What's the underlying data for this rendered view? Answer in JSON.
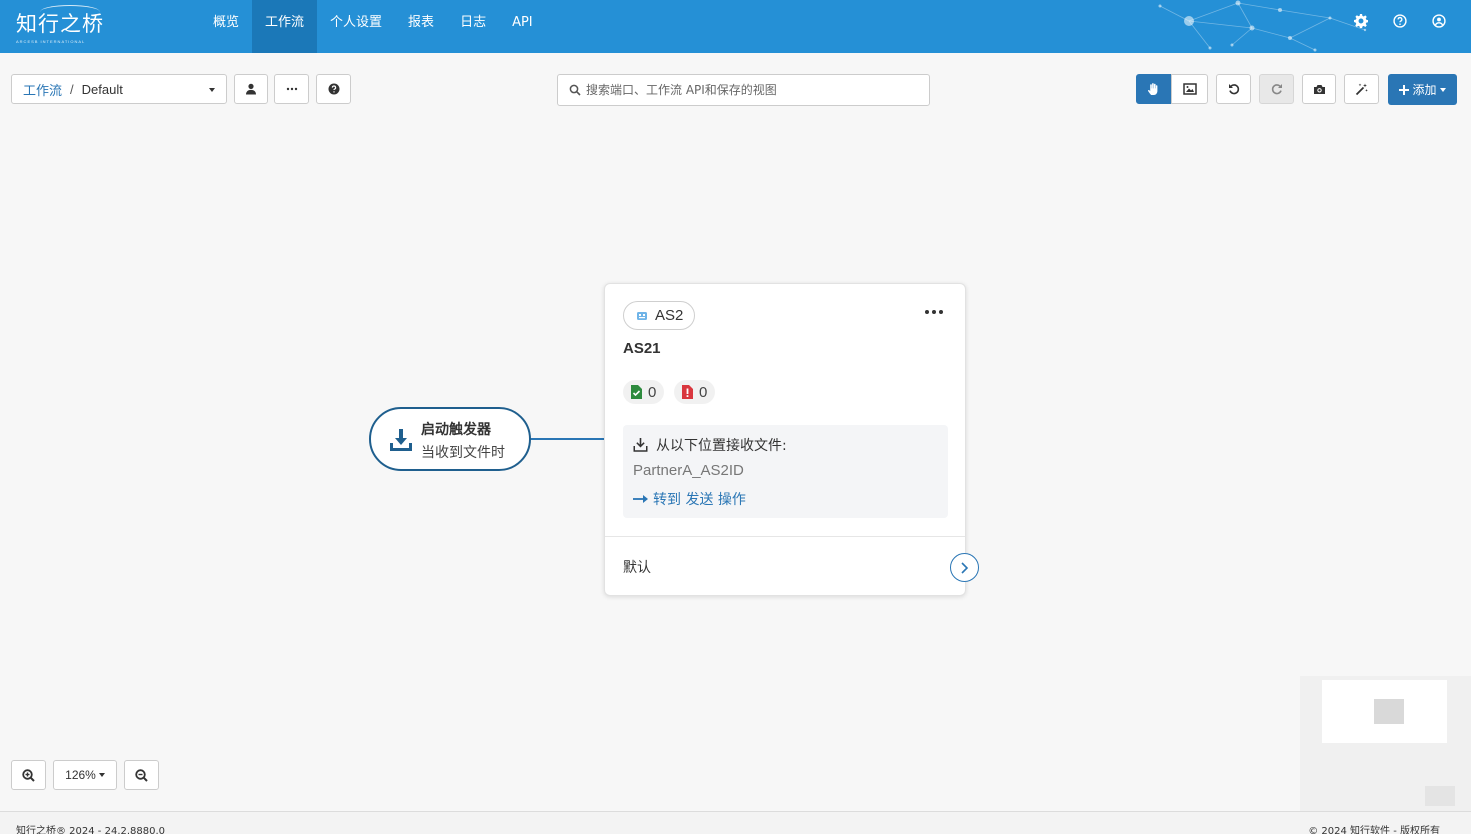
{
  "header": {
    "logo_main": "知行之桥",
    "logo_sub": "ARCESB INTERNATIONAL",
    "nav": [
      {
        "label": "概览",
        "active": false
      },
      {
        "label": "工作流",
        "active": true
      },
      {
        "label": "个人设置",
        "active": false
      },
      {
        "label": "报表",
        "active": false
      },
      {
        "label": "日志",
        "active": false
      },
      {
        "label": "API",
        "active": false
      }
    ]
  },
  "toolbar": {
    "breadcrumb_root": "工作流",
    "breadcrumb_sep": "/",
    "breadcrumb_current": "Default",
    "search_placeholder": "搜索端口、工作流 API和保存的视图",
    "add_label": "添加"
  },
  "trigger": {
    "title": "启动触发器",
    "subtitle": "当收到文件时"
  },
  "card": {
    "type_label": "AS2",
    "name": "AS21",
    "success_count": "0",
    "error_count": "0",
    "receive_label": "从以下位置接收文件:",
    "receive_id": "PartnerA_AS2ID",
    "goto_label": "转到 发送 操作",
    "footer_label": "默认"
  },
  "zoom": {
    "level": "126%"
  },
  "footer": {
    "left": "知行之桥® 2024 - 24.2.8880.0",
    "right": "© 2024 知行软件 - 版权所有"
  },
  "colors": {
    "nav_bg": "#2590d6",
    "nav_active": "#1b78b8",
    "primary": "#2a76b5",
    "success": "#2e8b3e",
    "error": "#d9363e"
  }
}
